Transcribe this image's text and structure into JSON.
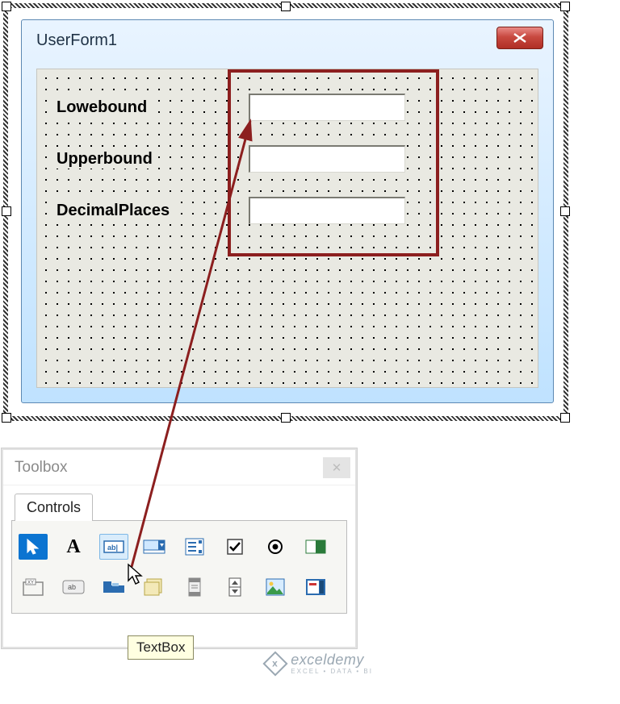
{
  "userform": {
    "title": "UserForm1",
    "labels": {
      "lowerbound": "Lowebound",
      "upperbound": "Upperbound",
      "decimalplaces": "DecimalPlaces"
    },
    "textboxes": {
      "lowerbound": "",
      "upperbound": "",
      "decimalplaces": ""
    }
  },
  "toolbox": {
    "title": "Toolbox",
    "tab": "Controls",
    "tooltip": "TextBox",
    "items_row1": [
      "pointer",
      "label",
      "textbox",
      "combobox",
      "listbox",
      "checkbox",
      "optionbutton",
      "togglebutton"
    ],
    "items_row2": [
      "frame",
      "commandbutton",
      "tabstrip",
      "multipage",
      "scrollbar",
      "spinbutton",
      "image",
      "refedit"
    ]
  },
  "watermark": {
    "brand": "exceldemy",
    "tagline": "EXCEL • DATA • BI"
  }
}
